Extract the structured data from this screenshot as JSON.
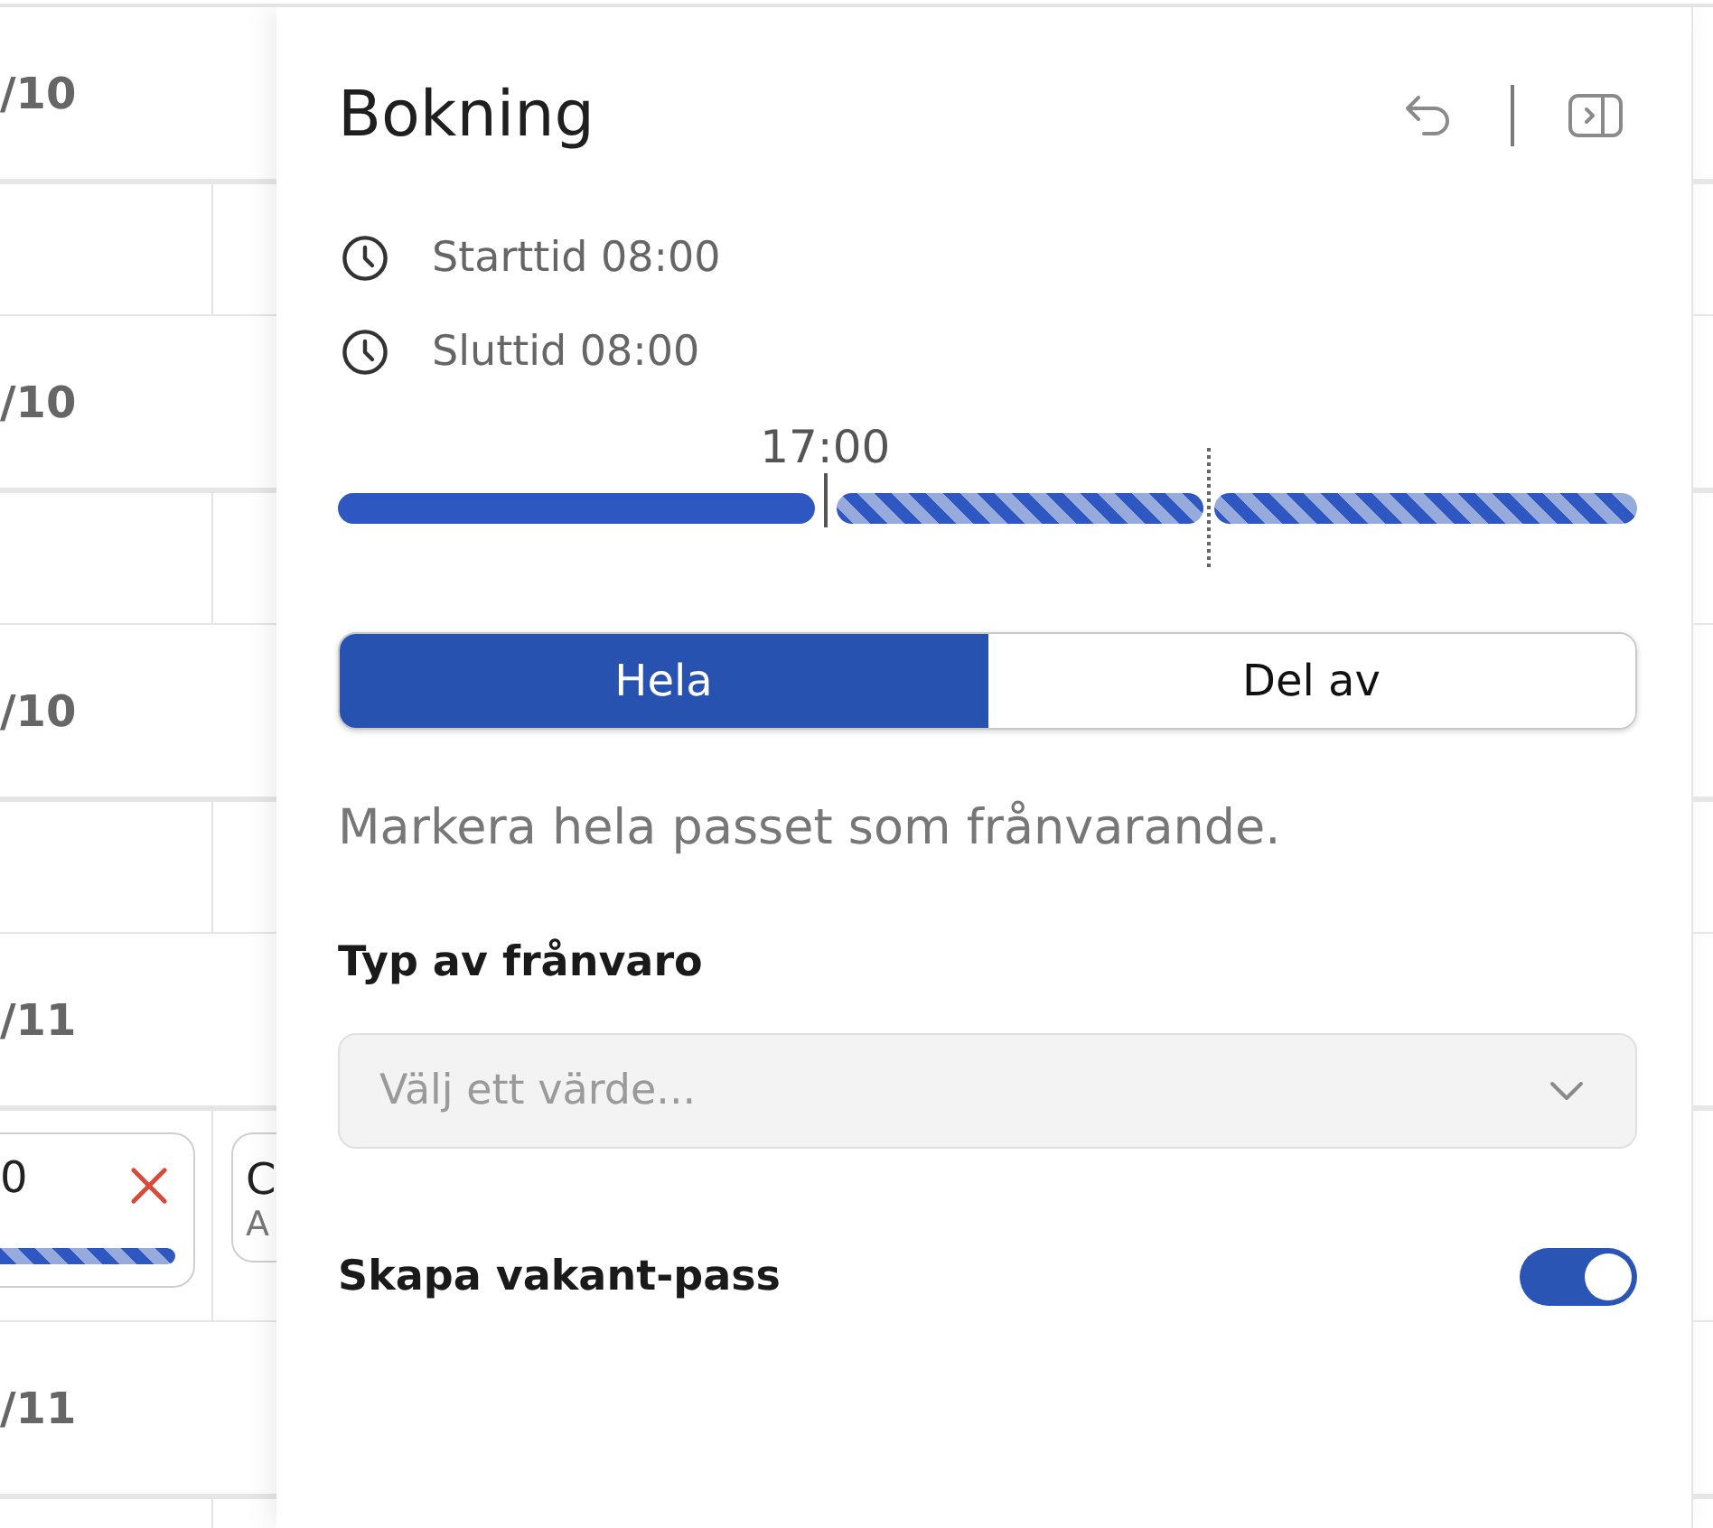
{
  "calendar": {
    "rows": [
      {
        "kind": "date",
        "label": "/10"
      },
      {
        "kind": "slots"
      },
      {
        "kind": "date",
        "label": "/10"
      },
      {
        "kind": "slots"
      },
      {
        "kind": "date",
        "label": "/10"
      },
      {
        "kind": "slots"
      },
      {
        "kind": "date",
        "label": "/11"
      },
      {
        "kind": "slots",
        "shifts": [
          {
            "time": "0",
            "absent": true
          },
          {
            "time": "C",
            "label": "A"
          }
        ]
      },
      {
        "kind": "date",
        "label": "/11"
      },
      {
        "kind": "slots"
      }
    ]
  },
  "panel": {
    "title": "Bokning",
    "times": [
      {
        "label": "Starttid 08:00"
      },
      {
        "label": "Sluttid 08:00"
      }
    ],
    "timeline": {
      "segments": [
        {
          "kind": "solid"
        },
        {
          "kind": "striped"
        },
        {
          "kind": "striped"
        }
      ],
      "markers": [
        {
          "kind": "line",
          "label": "17:00"
        },
        {
          "kind": "dotted"
        }
      ]
    },
    "mode_tabs": [
      {
        "label": "Hela",
        "selected": true
      },
      {
        "label": "Del av",
        "selected": false
      }
    ],
    "description": "Markera hela passet som frånvarande.",
    "absence_type": {
      "label": "Typ av frånvaro",
      "placeholder": "Välj ett värde..."
    },
    "vacant_shift": {
      "label": "Skapa vakant-pass",
      "on": true
    }
  }
}
